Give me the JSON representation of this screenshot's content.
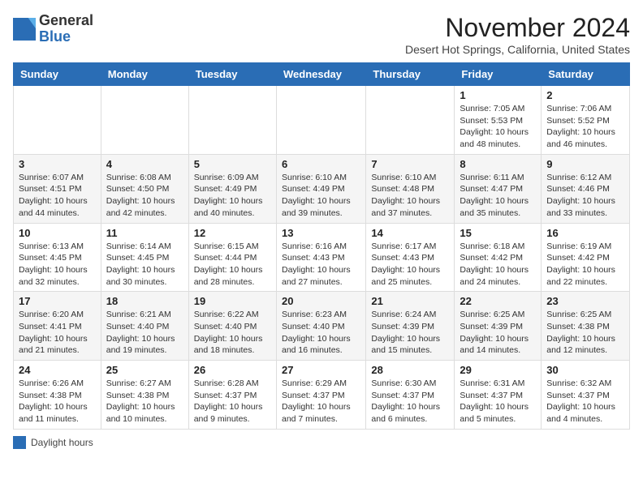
{
  "header": {
    "logo_line1": "General",
    "logo_line2": "Blue",
    "month_title": "November 2024",
    "location": "Desert Hot Springs, California, United States"
  },
  "columns": [
    "Sunday",
    "Monday",
    "Tuesday",
    "Wednesday",
    "Thursday",
    "Friday",
    "Saturday"
  ],
  "weeks": [
    [
      {
        "day": "",
        "info": ""
      },
      {
        "day": "",
        "info": ""
      },
      {
        "day": "",
        "info": ""
      },
      {
        "day": "",
        "info": ""
      },
      {
        "day": "",
        "info": ""
      },
      {
        "day": "1",
        "info": "Sunrise: 7:05 AM\nSunset: 5:53 PM\nDaylight: 10 hours and 48 minutes."
      },
      {
        "day": "2",
        "info": "Sunrise: 7:06 AM\nSunset: 5:52 PM\nDaylight: 10 hours and 46 minutes."
      }
    ],
    [
      {
        "day": "3",
        "info": "Sunrise: 6:07 AM\nSunset: 4:51 PM\nDaylight: 10 hours and 44 minutes."
      },
      {
        "day": "4",
        "info": "Sunrise: 6:08 AM\nSunset: 4:50 PM\nDaylight: 10 hours and 42 minutes."
      },
      {
        "day": "5",
        "info": "Sunrise: 6:09 AM\nSunset: 4:49 PM\nDaylight: 10 hours and 40 minutes."
      },
      {
        "day": "6",
        "info": "Sunrise: 6:10 AM\nSunset: 4:49 PM\nDaylight: 10 hours and 39 minutes."
      },
      {
        "day": "7",
        "info": "Sunrise: 6:10 AM\nSunset: 4:48 PM\nDaylight: 10 hours and 37 minutes."
      },
      {
        "day": "8",
        "info": "Sunrise: 6:11 AM\nSunset: 4:47 PM\nDaylight: 10 hours and 35 minutes."
      },
      {
        "day": "9",
        "info": "Sunrise: 6:12 AM\nSunset: 4:46 PM\nDaylight: 10 hours and 33 minutes."
      }
    ],
    [
      {
        "day": "10",
        "info": "Sunrise: 6:13 AM\nSunset: 4:45 PM\nDaylight: 10 hours and 32 minutes."
      },
      {
        "day": "11",
        "info": "Sunrise: 6:14 AM\nSunset: 4:45 PM\nDaylight: 10 hours and 30 minutes."
      },
      {
        "day": "12",
        "info": "Sunrise: 6:15 AM\nSunset: 4:44 PM\nDaylight: 10 hours and 28 minutes."
      },
      {
        "day": "13",
        "info": "Sunrise: 6:16 AM\nSunset: 4:43 PM\nDaylight: 10 hours and 27 minutes."
      },
      {
        "day": "14",
        "info": "Sunrise: 6:17 AM\nSunset: 4:43 PM\nDaylight: 10 hours and 25 minutes."
      },
      {
        "day": "15",
        "info": "Sunrise: 6:18 AM\nSunset: 4:42 PM\nDaylight: 10 hours and 24 minutes."
      },
      {
        "day": "16",
        "info": "Sunrise: 6:19 AM\nSunset: 4:42 PM\nDaylight: 10 hours and 22 minutes."
      }
    ],
    [
      {
        "day": "17",
        "info": "Sunrise: 6:20 AM\nSunset: 4:41 PM\nDaylight: 10 hours and 21 minutes."
      },
      {
        "day": "18",
        "info": "Sunrise: 6:21 AM\nSunset: 4:40 PM\nDaylight: 10 hours and 19 minutes."
      },
      {
        "day": "19",
        "info": "Sunrise: 6:22 AM\nSunset: 4:40 PM\nDaylight: 10 hours and 18 minutes."
      },
      {
        "day": "20",
        "info": "Sunrise: 6:23 AM\nSunset: 4:40 PM\nDaylight: 10 hours and 16 minutes."
      },
      {
        "day": "21",
        "info": "Sunrise: 6:24 AM\nSunset: 4:39 PM\nDaylight: 10 hours and 15 minutes."
      },
      {
        "day": "22",
        "info": "Sunrise: 6:25 AM\nSunset: 4:39 PM\nDaylight: 10 hours and 14 minutes."
      },
      {
        "day": "23",
        "info": "Sunrise: 6:25 AM\nSunset: 4:38 PM\nDaylight: 10 hours and 12 minutes."
      }
    ],
    [
      {
        "day": "24",
        "info": "Sunrise: 6:26 AM\nSunset: 4:38 PM\nDaylight: 10 hours and 11 minutes."
      },
      {
        "day": "25",
        "info": "Sunrise: 6:27 AM\nSunset: 4:38 PM\nDaylight: 10 hours and 10 minutes."
      },
      {
        "day": "26",
        "info": "Sunrise: 6:28 AM\nSunset: 4:37 PM\nDaylight: 10 hours and 9 minutes."
      },
      {
        "day": "27",
        "info": "Sunrise: 6:29 AM\nSunset: 4:37 PM\nDaylight: 10 hours and 7 minutes."
      },
      {
        "day": "28",
        "info": "Sunrise: 6:30 AM\nSunset: 4:37 PM\nDaylight: 10 hours and 6 minutes."
      },
      {
        "day": "29",
        "info": "Sunrise: 6:31 AM\nSunset: 4:37 PM\nDaylight: 10 hours and 5 minutes."
      },
      {
        "day": "30",
        "info": "Sunrise: 6:32 AM\nSunset: 4:37 PM\nDaylight: 10 hours and 4 minutes."
      }
    ]
  ],
  "legend": {
    "color_label": "Daylight hours"
  }
}
